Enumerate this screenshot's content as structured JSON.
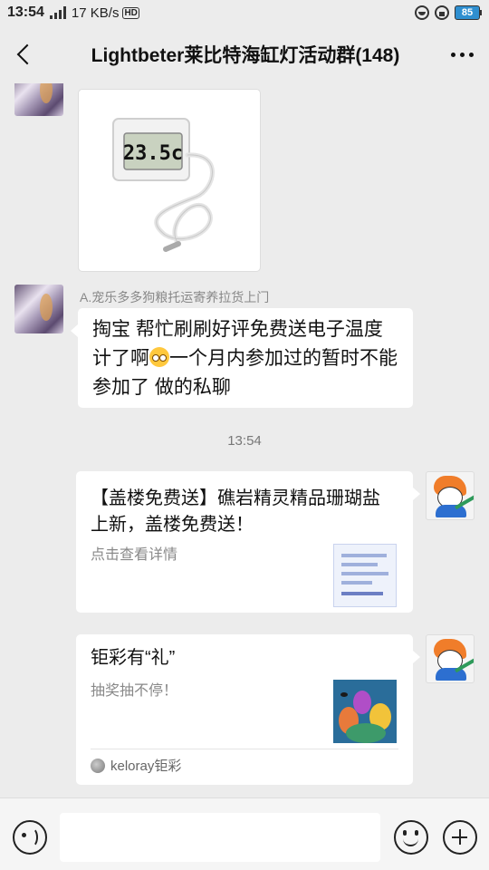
{
  "status_bar": {
    "time": "13:54",
    "network_type": "4G",
    "speed": "17 KB/s",
    "hd_label": "HD",
    "battery": "85"
  },
  "header": {
    "title": "Lightbeter莱比特海缸灯活动群(148)"
  },
  "messages": [
    {
      "type": "image",
      "side": "left",
      "image_display": "23.5c"
    },
    {
      "type": "text",
      "side": "left",
      "sender": "A.宠乐多多狗粮托运寄养拉货上门",
      "text_part1": "掏宝 帮忙刷刷好评免费送电子温度计了啊",
      "text_part2": "一个月内参加过的暂时不能参加了 做的私聊",
      "emoji": "flushed-face-emoji"
    },
    {
      "type": "time",
      "text": "13:54"
    },
    {
      "type": "card",
      "side": "right",
      "title": "【盖楼免费送】礁岩精灵精品珊瑚盐上新，盖楼免费送！",
      "desc": "点击查看详情"
    },
    {
      "type": "card",
      "side": "right",
      "title": "钜彩有“礼”",
      "desc": "抽奖抽不停！",
      "source": "keloray钜彩"
    }
  ],
  "input_bar": {
    "value": ""
  },
  "colors": {
    "background": "#ececec",
    "bubble": "#ffffff",
    "battery": "#2f8fd0"
  }
}
